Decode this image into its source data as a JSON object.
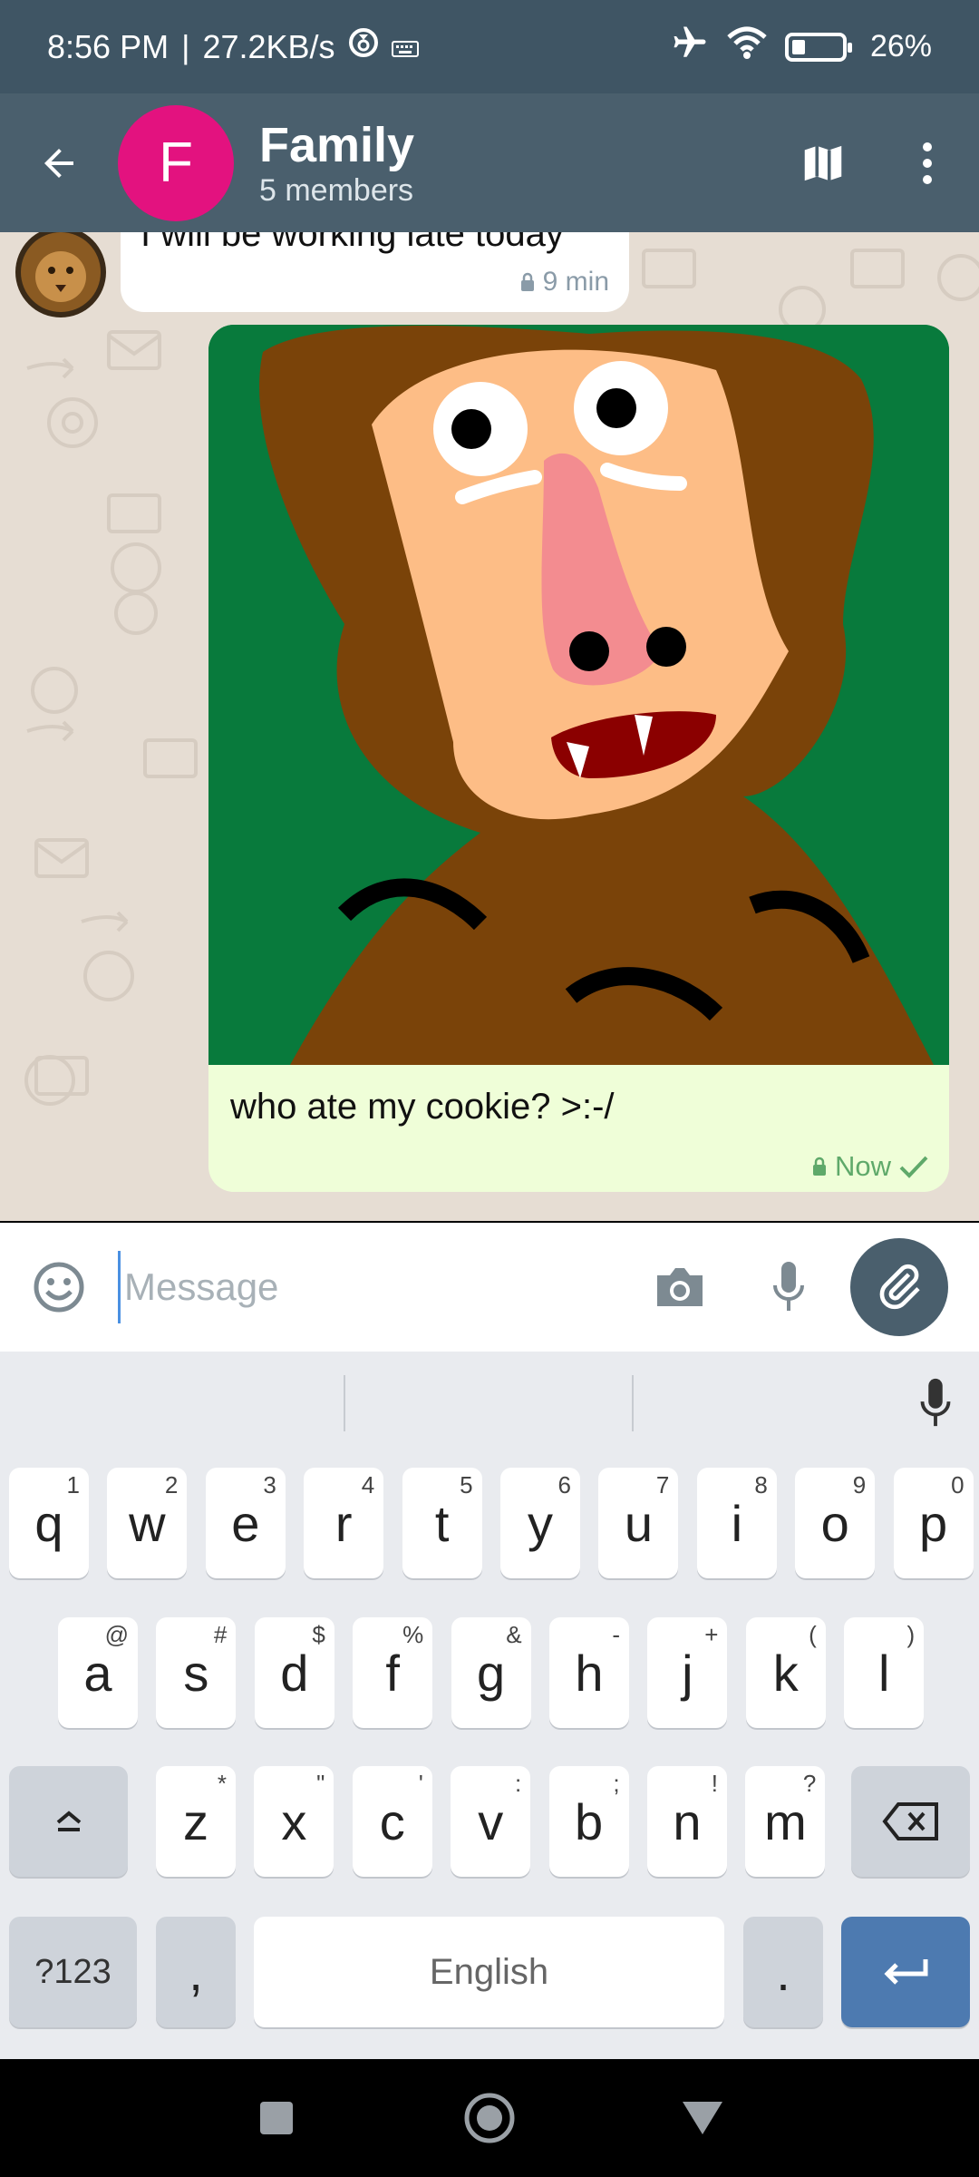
{
  "status_bar": {
    "time": "8:56 PM",
    "separator": "|",
    "speed": "27.2KB/s",
    "battery": "26%"
  },
  "header": {
    "avatar_letter": "F",
    "title": "Family",
    "subtitle": "5 members"
  },
  "messages": [
    {
      "direction": "incoming",
      "text": "I will be working late today",
      "time": "9 min"
    },
    {
      "direction": "outgoing",
      "caption": "who ate my cookie? >:-/",
      "time": "Now",
      "status": "read"
    }
  ],
  "composer": {
    "placeholder": "Message",
    "value": ""
  },
  "keyboard": {
    "row1": [
      [
        "q",
        "1"
      ],
      [
        "w",
        "2"
      ],
      [
        "e",
        "3"
      ],
      [
        "r",
        "4"
      ],
      [
        "t",
        "5"
      ],
      [
        "y",
        "6"
      ],
      [
        "u",
        "7"
      ],
      [
        "i",
        "8"
      ],
      [
        "o",
        "9"
      ],
      [
        "p",
        "0"
      ]
    ],
    "row2": [
      [
        "a",
        "@"
      ],
      [
        "s",
        "#"
      ],
      [
        "d",
        "$"
      ],
      [
        "f",
        "%"
      ],
      [
        "g",
        "&"
      ],
      [
        "h",
        "-"
      ],
      [
        "j",
        "+"
      ],
      [
        "k",
        "("
      ],
      [
        "l",
        ")"
      ]
    ],
    "row3": [
      [
        "z",
        "*"
      ],
      [
        "x",
        "\""
      ],
      [
        "c",
        "'"
      ],
      [
        "v",
        ":"
      ],
      [
        "b",
        ";"
      ],
      [
        "n",
        "!"
      ],
      [
        "m",
        "?"
      ]
    ],
    "symbols_label": "?123",
    "comma": ",",
    "space_label": "English",
    "period": "."
  },
  "colors": {
    "status_bar": "#3f5564",
    "app_bar": "#4a5f6d",
    "avatar": "#e3127f",
    "chat_bg": "#e6ddd3",
    "outgoing_bubble": "#effed8",
    "enter_key": "#4d7ab0"
  }
}
